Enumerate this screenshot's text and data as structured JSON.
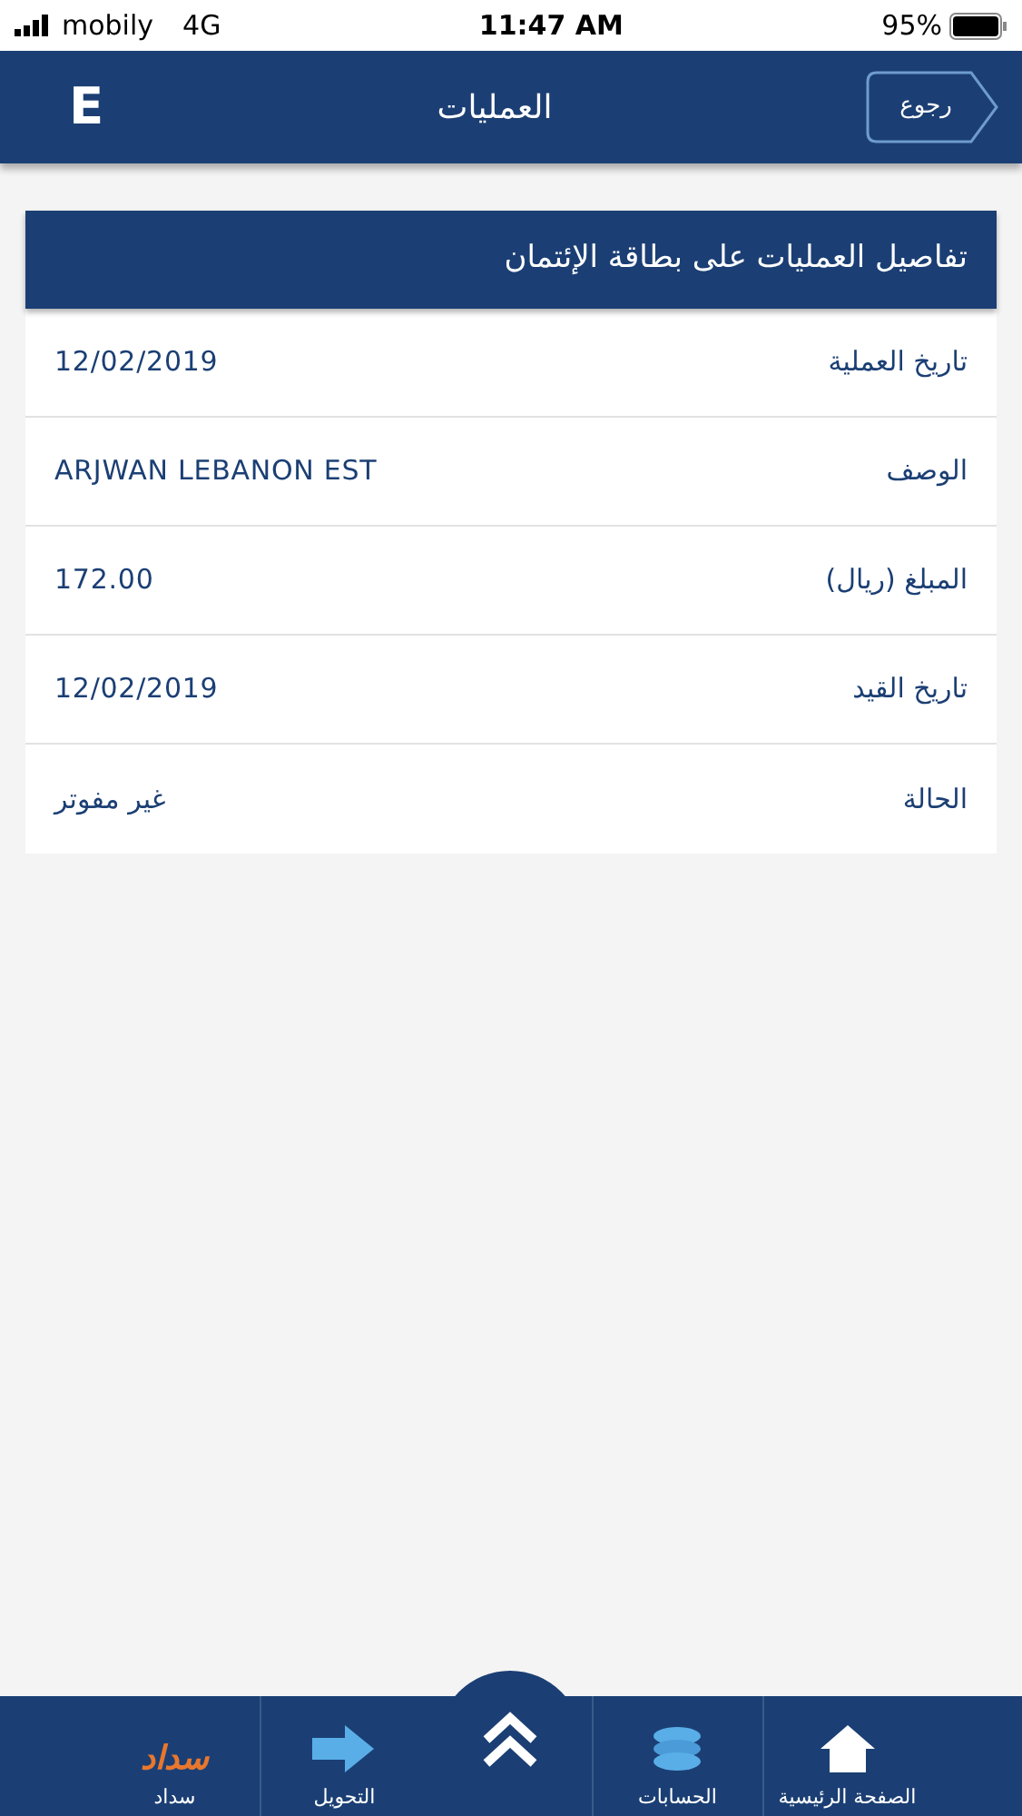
{
  "status_bar": {
    "carrier": "mobily",
    "network": "4G",
    "time": "11:47 AM",
    "battery": "95%"
  },
  "header": {
    "title": "العمليات",
    "back_label": "رجوع",
    "logo": "E"
  },
  "card": {
    "title": "تفاصيل العمليات على بطاقة الإئتمان",
    "rows": [
      {
        "label": "تاريخ العملية",
        "value": "12/02/2019"
      },
      {
        "label": "الوصف",
        "value": "ARJWAN LEBANON EST"
      },
      {
        "label": "المبلغ (ريال)",
        "value": "172.00"
      },
      {
        "label": "تاريخ القيد",
        "value": "12/02/2019"
      },
      {
        "label": "الحالة",
        "value": "غير مفوتر"
      }
    ]
  },
  "bottom_nav": [
    {
      "kind": "home",
      "label": "الصفحة الرئيسية"
    },
    {
      "kind": "accounts",
      "label": "الحسابات"
    },
    {
      "kind": "center"
    },
    {
      "kind": "transfer",
      "label": "التحويل"
    },
    {
      "kind": "sadad",
      "label": "سداد",
      "logo_text": "سداد"
    }
  ]
}
